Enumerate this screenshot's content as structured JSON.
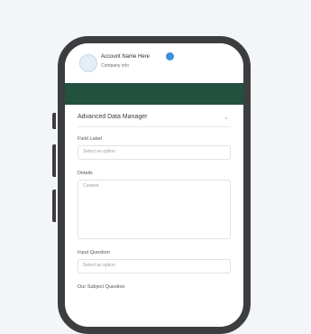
{
  "profile": {
    "name": "Account Name Here",
    "subtitle": "Company info"
  },
  "form": {
    "section_title": "Advanced Data Manager",
    "fields": [
      {
        "label": "Field Label",
        "placeholder": "Select an option"
      },
      {
        "label": "Details",
        "placeholder": "Content"
      },
      {
        "label": "Input Question",
        "placeholder": "Select an option"
      },
      {
        "label": "Our Subject Question",
        "placeholder": ""
      }
    ]
  },
  "colors": {
    "banner": "#22513f",
    "page_bg": "#f4f5f9",
    "phone_frame": "#3c3d3e",
    "verified_badge": "#3c8fd8"
  }
}
